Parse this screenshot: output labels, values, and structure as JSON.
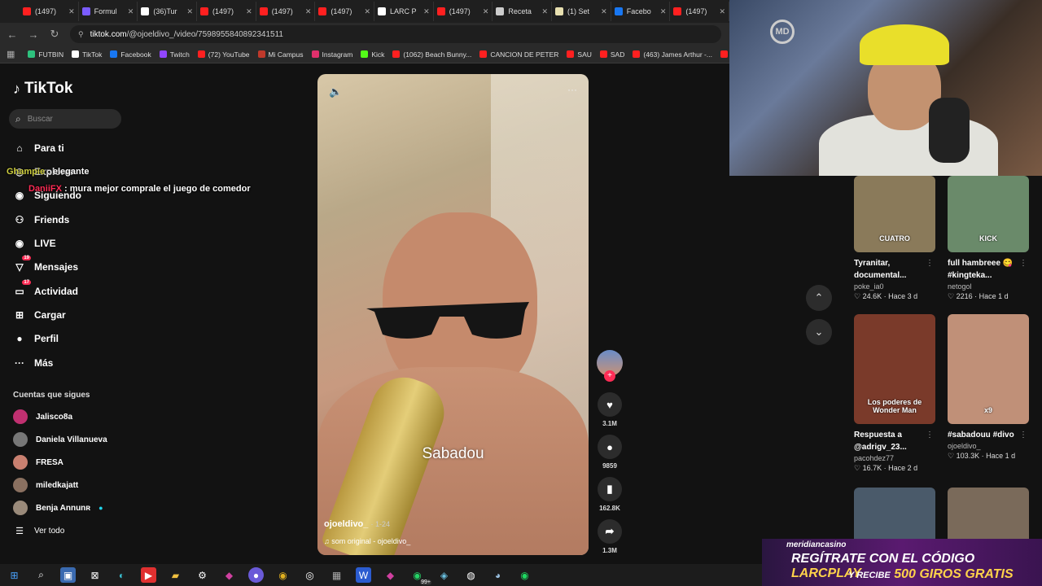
{
  "browser": {
    "tabs": [
      {
        "label": "(1497) ",
        "color": "#ff2020"
      },
      {
        "label": "Formul",
        "color": "#7a5cff"
      },
      {
        "label": "(36)Tur",
        "color": "#ffffff"
      },
      {
        "label": "(1497)",
        "color": "#ff2020"
      },
      {
        "label": "(1497)",
        "color": "#ff2020"
      },
      {
        "label": "(1497)",
        "color": "#ff2020"
      },
      {
        "label": "LARC P",
        "color": "#ffffff"
      },
      {
        "label": "(1497)",
        "color": "#ff2020"
      },
      {
        "label": "Receta",
        "color": "#cccccc"
      },
      {
        "label": "(1) Set",
        "color": "#e8e0b0"
      },
      {
        "label": "Facebo",
        "color": "#1877f2"
      },
      {
        "label": "(1497)",
        "color": "#ff2020"
      }
    ],
    "url_host": "tiktok.com",
    "url_path": "/@ojoeldivo_/video/7598955840892341511",
    "bookmarks": [
      {
        "label": "FUTBIN",
        "color": "#2ec27e"
      },
      {
        "label": "TikTok",
        "color": "#ffffff"
      },
      {
        "label": "Facebook",
        "color": "#1877f2"
      },
      {
        "label": "Twitch",
        "color": "#9146ff"
      },
      {
        "label": "(72) YouTube",
        "color": "#ff2020"
      },
      {
        "label": "Mi Campus",
        "color": "#c0392b"
      },
      {
        "label": "Instagram",
        "color": "#e1306c"
      },
      {
        "label": "Kick",
        "color": "#53fc18"
      },
      {
        "label": "(1062) Beach Bunny...",
        "color": "#ff2020"
      },
      {
        "label": "CANCION DE PETER",
        "color": "#ff2020"
      },
      {
        "label": "SAU",
        "color": "#ff2020"
      },
      {
        "label": "SAD",
        "color": "#ff2020"
      },
      {
        "label": "(463) James Arthur -...",
        "color": "#ff2020"
      },
      {
        "label": "DRA",
        "color": "#ff2020"
      }
    ]
  },
  "sidebar": {
    "logo": "TikTok",
    "search_placeholder": "Buscar",
    "nav": [
      {
        "label": "Para ti",
        "icon": "home-icon",
        "glyph": "⌂",
        "badge": ""
      },
      {
        "label": "Explorar",
        "icon": "compass-icon",
        "glyph": "◎",
        "badge": ""
      },
      {
        "label": "Siguiendo",
        "icon": "following-icon",
        "glyph": "◉",
        "badge": ""
      },
      {
        "label": "Friends",
        "icon": "friends-icon",
        "glyph": "⚇",
        "badge": ""
      },
      {
        "label": "LIVE",
        "icon": "live-icon",
        "glyph": "◉",
        "badge": ""
      },
      {
        "label": "Mensajes",
        "icon": "messages-icon",
        "glyph": "▽",
        "badge": "19"
      },
      {
        "label": "Actividad",
        "icon": "activity-icon",
        "glyph": "▭",
        "badge": "17"
      },
      {
        "label": "Cargar",
        "icon": "upload-icon",
        "glyph": "⊞",
        "badge": ""
      },
      {
        "label": "Perfil",
        "icon": "profile-icon",
        "glyph": "●",
        "badge": ""
      },
      {
        "label": "Más",
        "icon": "more-icon",
        "glyph": "···",
        "badge": ""
      }
    ],
    "following_title": "Cuentas que sigues",
    "following": [
      {
        "name": "Jalisco8a",
        "color": "#c03070",
        "verified": false
      },
      {
        "name": "Daniela Villanueva",
        "color": "#777777",
        "verified": false
      },
      {
        "name": "FRESA",
        "color": "#c98070",
        "verified": false
      },
      {
        "name": "miledkajatt",
        "color": "#8a7060",
        "verified": false
      },
      {
        "name": "Benja Annunʀ",
        "color": "#9a8a7a",
        "verified": true
      }
    ],
    "see_all": "Ver todo"
  },
  "chat": [
    {
      "user": "Ghampie",
      "text": "elegante",
      "color": "#d0d040"
    },
    {
      "user": "DaniiFX",
      "text": "mura mejor comprale el juego de comedor",
      "color": "#fe2c55"
    }
  ],
  "video": {
    "caption_text": "Sabadou",
    "author": "ojoeldivo_",
    "date": "1-24",
    "sound": "som original - ojoeldivo_"
  },
  "actions": {
    "likes": "3.1M",
    "comments": "9859",
    "saves": "162.8K",
    "shares": "1.3M"
  },
  "related": [
    {
      "title": "Tyranitar, documental...",
      "user": "poke_ia0",
      "likes": "24.6K",
      "age": "Hace 3 d",
      "overlay": "CUATRO",
      "color": "#8a7a5a"
    },
    {
      "title": "full hambreee 😋 #kingteka...",
      "user": "netogol",
      "likes": "2216",
      "age": "Hace 1 d",
      "overlay": "KICK",
      "color": "#6a8a6a"
    },
    {
      "title": "Respuesta a @adrigv_23...",
      "user": "pacohdez77",
      "likes": "16.7K",
      "age": "Hace 2 d",
      "overlay": "Los poderes de Wonder Man",
      "color": "#7a3a2a"
    },
    {
      "title": "#sabadouu #divo",
      "user": "ojoeldivo_",
      "likes": "103.3K",
      "age": "Hace 1 d",
      "overlay": "x9",
      "color": "#c09078"
    },
    {
      "title": "",
      "user": "",
      "likes": "",
      "age": "",
      "overlay": "",
      "color": "#4a5a6a"
    },
    {
      "title": "",
      "user": "",
      "likes": "",
      "age": "",
      "overlay": "",
      "color": "#7a6a5a"
    }
  ],
  "webcam": {
    "logo": "MD"
  },
  "ad": {
    "brand": "meridiancasino",
    "line1": "REGÍTRATE CON EL CÓDIGO",
    "code": "LARCPLAY",
    "line2_prefix": "Y RECIBE",
    "line2": "500 GIROS GRATIS"
  },
  "taskbar": {
    "badge": "99+"
  }
}
